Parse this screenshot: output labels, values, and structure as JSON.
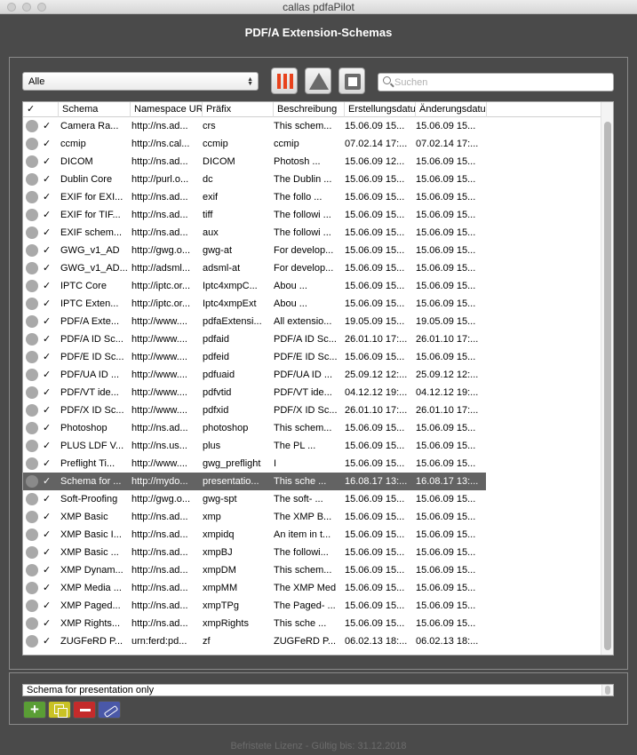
{
  "window": {
    "title": "callas pdfaPilot"
  },
  "header": {
    "title": "PDF/A Extension-Schemas"
  },
  "toolbar": {
    "filter_value": "Alle",
    "icons": [
      "columns-icon",
      "triangle-icon",
      "square-icon"
    ],
    "search_placeholder": "Suchen"
  },
  "table": {
    "columns": [
      "✓",
      "Schema",
      "Namespace UR",
      "Präfix",
      "Beschreibung",
      "Erstellungsdatu",
      "Änderungsdatu"
    ],
    "rows": [
      {
        "schema": "Camera Ra...",
        "ns": "http://ns.ad...",
        "prefix": "crs",
        "desc": "This schem...",
        "created": "15.06.09 15...",
        "modified": "15.06.09 15..."
      },
      {
        "schema": "ccmip",
        "ns": "http://ns.cal...",
        "prefix": "ccmip",
        "desc": "ccmip",
        "created": "07.02.14 17:...",
        "modified": "07.02.14 17:..."
      },
      {
        "schema": "DICOM",
        "ns": "http://ns.ad...",
        "prefix": "DICOM",
        "desc": "Photosh      ...",
        "created": "15.06.09 12...",
        "modified": "15.06.09 15..."
      },
      {
        "schema": "Dublin Core",
        "ns": "http://purl.o...",
        "prefix": "dc",
        "desc": "The Dublin   ...",
        "created": "15.06.09 15...",
        "modified": "15.06.09 15..."
      },
      {
        "schema": "EXIF for EXI...",
        "ns": "http://ns.ad...",
        "prefix": "exif",
        "desc": "The follo     ...",
        "created": "15.06.09 15...",
        "modified": "15.06.09 15..."
      },
      {
        "schema": "EXIF for TIF...",
        "ns": "http://ns.ad...",
        "prefix": "tiff",
        "desc": "The followi  ...",
        "created": "15.06.09 15...",
        "modified": "15.06.09 15..."
      },
      {
        "schema": "EXIF schem...",
        "ns": "http://ns.ad...",
        "prefix": "aux",
        "desc": "The followi  ...",
        "created": "15.06.09 15...",
        "modified": "15.06.09 15..."
      },
      {
        "schema": "GWG_v1_AD",
        "ns": "http://gwg.o...",
        "prefix": "gwg-at",
        "desc": "For develop...",
        "created": "15.06.09 15...",
        "modified": "15.06.09 15..."
      },
      {
        "schema": "GWG_v1_AD...",
        "ns": "http://adsml...",
        "prefix": "adsml-at",
        "desc": "For develop...",
        "created": "15.06.09 15...",
        "modified": "15.06.09 15..."
      },
      {
        "schema": "IPTC Core",
        "ns": "http://iptc.or...",
        "prefix": "Iptc4xmpC...",
        "desc": "Abou          ...",
        "created": "15.06.09 15...",
        "modified": "15.06.09 15..."
      },
      {
        "schema": "IPTC Exten...",
        "ns": "http://iptc.or...",
        "prefix": "Iptc4xmpExt",
        "desc": "Abou          ...",
        "created": "15.06.09 15...",
        "modified": "15.06.09 15..."
      },
      {
        "schema": "PDF/A Exte...",
        "ns": "http://www....",
        "prefix": "pdfaExtensi...",
        "desc": "All extensio...",
        "created": "19.05.09 15...",
        "modified": "19.05.09 15..."
      },
      {
        "schema": "PDF/A ID Sc...",
        "ns": "http://www....",
        "prefix": "pdfaid",
        "desc": "PDF/A ID Sc...",
        "created": "26.01.10 17:...",
        "modified": "26.01.10 17:..."
      },
      {
        "schema": "PDF/E ID Sc...",
        "ns": "http://www....",
        "prefix": "pdfeid",
        "desc": "PDF/E ID Sc...",
        "created": "15.06.09 15...",
        "modified": "15.06.09 15..."
      },
      {
        "schema": "PDF/UA ID ...",
        "ns": "http://www....",
        "prefix": "pdfuaid",
        "desc": "PDF/UA ID ...",
        "created": "25.09.12 12:...",
        "modified": "25.09.12 12:..."
      },
      {
        "schema": "PDF/VT ide...",
        "ns": "http://www....",
        "prefix": "pdfvtid",
        "desc": "PDF/VT ide...",
        "created": "04.12.12 19:...",
        "modified": "04.12.12 19:..."
      },
      {
        "schema": "PDF/X ID Sc...",
        "ns": "http://www....",
        "prefix": "pdfxid",
        "desc": "PDF/X ID Sc...",
        "created": "26.01.10 17:...",
        "modified": "26.01.10 17:..."
      },
      {
        "schema": "Photoshop",
        "ns": "http://ns.ad...",
        "prefix": "photoshop",
        "desc": "This schem...",
        "created": "15.06.09 15...",
        "modified": "15.06.09 15..."
      },
      {
        "schema": "PLUS LDF V...",
        "ns": "http://ns.us...",
        "prefix": "plus",
        "desc": "The PL       ...",
        "created": "15.06.09 15...",
        "modified": "15.06.09 15..."
      },
      {
        "schema": "Preflight Ti...",
        "ns": "http://www....",
        "prefix": "gwg_preflight",
        "desc": "I",
        "created": "15.06.09 15...",
        "modified": "15.06.09 15..."
      },
      {
        "schema": "Schema for ...",
        "ns": "http://mydo...",
        "prefix": "presentatio...",
        "desc": "This sche   ...",
        "created": "16.08.17 13:...",
        "modified": "16.08.17 13:...",
        "selected": true
      },
      {
        "schema": "Soft-Proofing",
        "ns": "http://gwg.o...",
        "prefix": "gwg-spt",
        "desc": "The soft-    ...",
        "created": "15.06.09 15...",
        "modified": "15.06.09 15..."
      },
      {
        "schema": "XMP Basic",
        "ns": "http://ns.ad...",
        "prefix": "xmp",
        "desc": "The XMP B...",
        "created": "15.06.09 15...",
        "modified": "15.06.09 15..."
      },
      {
        "schema": "XMP Basic I...",
        "ns": "http://ns.ad...",
        "prefix": "xmpidq",
        "desc": "An item in t...",
        "created": "15.06.09 15...",
        "modified": "15.06.09 15..."
      },
      {
        "schema": "XMP Basic ...",
        "ns": "http://ns.ad...",
        "prefix": "xmpBJ",
        "desc": "The followi...",
        "created": "15.06.09 15...",
        "modified": "15.06.09 15..."
      },
      {
        "schema": "XMP Dynam...",
        "ns": "http://ns.ad...",
        "prefix": "xmpDM",
        "desc": "This schem...",
        "created": "15.06.09 15...",
        "modified": "15.06.09 15..."
      },
      {
        "schema": "XMP Media ...",
        "ns": "http://ns.ad...",
        "prefix": "xmpMM",
        "desc": "The XMP Med",
        "created": "15.06.09 15...",
        "modified": "15.06.09 15..."
      },
      {
        "schema": "XMP Paged...",
        "ns": "http://ns.ad...",
        "prefix": "xmpTPg",
        "desc": "The Paged-  ...",
        "created": "15.06.09 15...",
        "modified": "15.06.09 15..."
      },
      {
        "schema": "XMP Rights...",
        "ns": "http://ns.ad...",
        "prefix": "xmpRights",
        "desc": "This sche    ...",
        "created": "15.06.09 15...",
        "modified": "15.06.09 15..."
      },
      {
        "schema": "ZUGFeRD P...",
        "ns": "urn:ferd:pd...",
        "prefix": "zf",
        "desc": "ZUGFeRD P...",
        "created": "06.02.13 18:...",
        "modified": "06.02.13 18:..."
      }
    ]
  },
  "detail": {
    "text": "Schema for presentation only"
  },
  "actions": {
    "icons": [
      "add-icon",
      "duplicate-icon",
      "remove-icon",
      "edit-icon"
    ]
  },
  "footer": {
    "license": "Befristete Lizenz - Gültig bis: 31.12.2018"
  },
  "colors": {
    "background": "#4a4a4a",
    "selection": "#636363",
    "accent": "#e8421c"
  }
}
